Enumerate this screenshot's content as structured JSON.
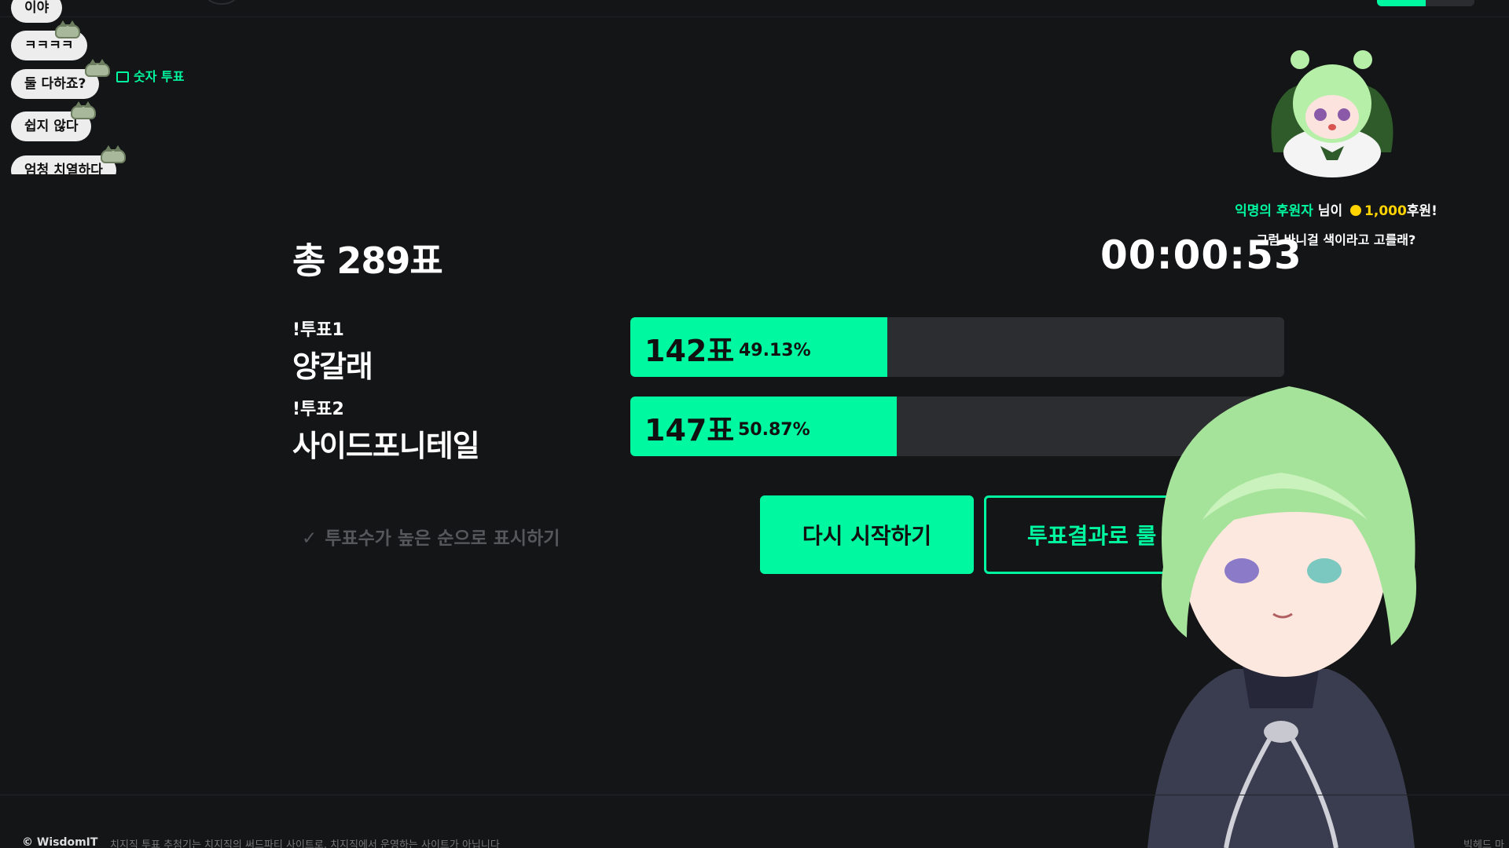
{
  "chat": {
    "messages": [
      "이야",
      "ㅋㅋㅋㅋ",
      "둘 다하죠?",
      "쉽지 않다",
      "엄청 치열하다"
    ],
    "vote_tag": "숫자 투표"
  },
  "vote": {
    "total_label": "총 289표",
    "timer": "00:00:53",
    "options": [
      {
        "command": "!투표1",
        "name": "양갈래",
        "count_label": "142표",
        "percent_label": "49.13%",
        "percent": 49.13
      },
      {
        "command": "!투표2",
        "name": "사이드포니테일",
        "count_label": "147표",
        "percent_label": "50.87%",
        "percent": 50.87
      }
    ],
    "sort_label": "투표수가 높은 순으로 표시하기",
    "restart_label": "다시 시작하기",
    "roulette_label": "투표결과로 룰"
  },
  "donation": {
    "donor": "익명의 후원자",
    "suffix": "님이",
    "amount": "1,000",
    "unit": "후원!",
    "message": "그럼 바니걸 색이라고 고를래?"
  },
  "footer": {
    "brand": "© WisdomIT",
    "notice": "치지직 투표 추첨기는 치지직의 써드파티 사이트로, 치지직에서 운영하는 사이트가 아닙니다",
    "right": "빅헤드 마"
  },
  "colors": {
    "accent": "#00f8a0",
    "background": "#141517",
    "bar_track": "#2c2d30"
  }
}
